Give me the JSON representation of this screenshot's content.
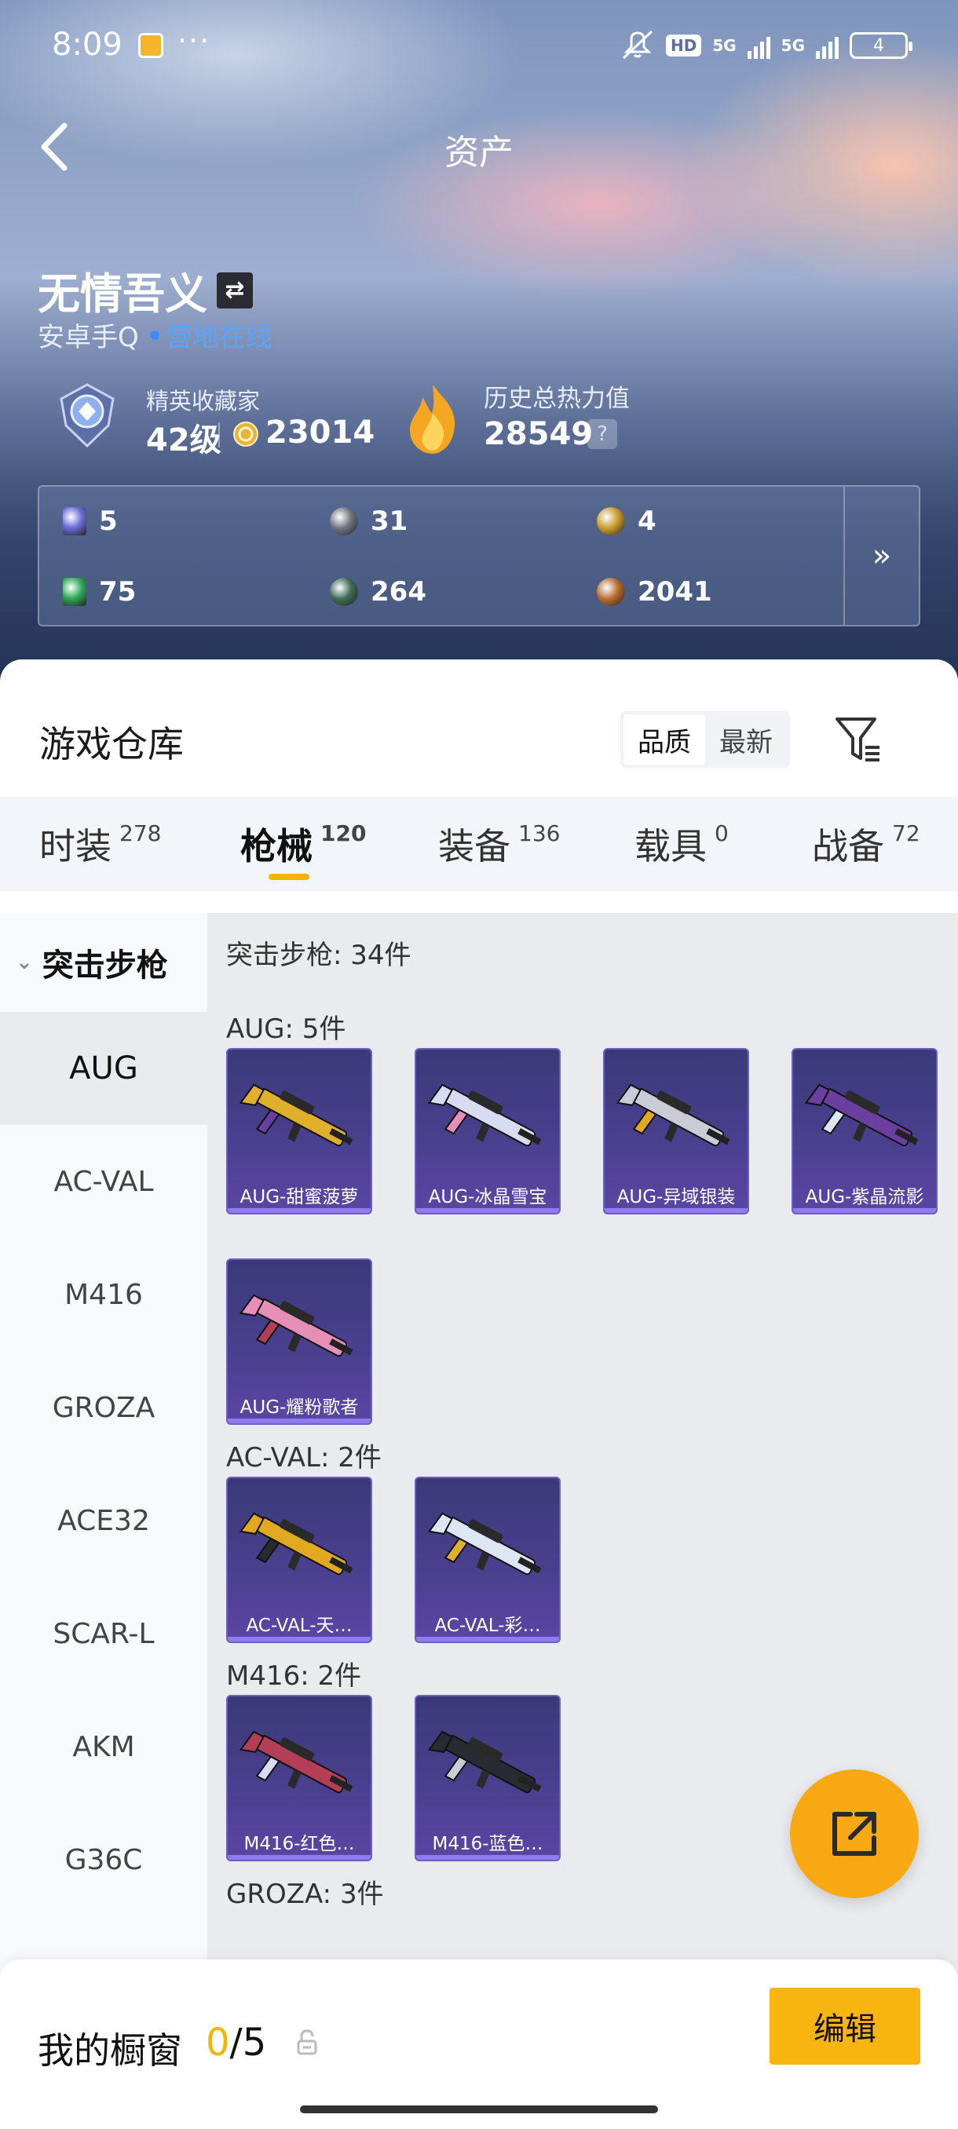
{
  "status_bar": {
    "time": "8:09",
    "hd": "HD",
    "net1": "5G",
    "net2": "5G",
    "battery": "4",
    "dots": "···"
  },
  "nav": {
    "title": "资产"
  },
  "profile": {
    "name": "无情吾义",
    "platform": "安卓手Q",
    "online": "营地在线",
    "rank_title": "精英收藏家",
    "rank_level": "42级",
    "coins": "23014",
    "heat_title": "历史总热力值",
    "heat_value": "28549",
    "help": "?"
  },
  "stats": [
    {
      "icon": "card-purple-icon",
      "value": "5",
      "color": "#6b6fd6"
    },
    {
      "icon": "silver-coin-icon",
      "value": "31",
      "color": "#6c7280"
    },
    {
      "icon": "gold-badge-icon",
      "value": "4",
      "color": "#c79a2a"
    },
    {
      "icon": "card-green-icon",
      "value": "75",
      "color": "#2faa5b"
    },
    {
      "icon": "green-orb-icon",
      "value": "264",
      "color": "#3d6b55"
    },
    {
      "icon": "bronze-orb-icon",
      "value": "2041",
      "color": "#b86a2c"
    }
  ],
  "warehouse": {
    "title": "游戏仓库",
    "sort": [
      "品质",
      "最新"
    ]
  },
  "tabs": [
    {
      "label": "时装",
      "count": "278"
    },
    {
      "label": "枪械",
      "count": "120"
    },
    {
      "label": "装备",
      "count": "136"
    },
    {
      "label": "载具",
      "count": "0"
    },
    {
      "label": "战备",
      "count": "72"
    }
  ],
  "sidebar": {
    "group": "突击步枪",
    "items": [
      "AUG",
      "AC-VAL",
      "M416",
      "GROZA",
      "ACE32",
      "SCAR-L",
      "AKM",
      "G36C"
    ]
  },
  "content": {
    "total": "突击步枪: 34件",
    "sections": [
      {
        "title": "AUG: 5件",
        "items": [
          "AUG-甜蜜菠萝",
          "AUG-冰晶雪宝",
          "AUG-异域银装",
          "AUG-紫晶流影",
          "AUG-耀粉歌者"
        ]
      },
      {
        "title": "AC-VAL: 2件",
        "items": [
          "AC-VAL-天…",
          "AC-VAL-彩…"
        ]
      },
      {
        "title": "M416: 2件",
        "items": [
          "M416-红色…",
          "M416-蓝色…"
        ]
      },
      {
        "title": "GROZA: 3件",
        "items": []
      }
    ]
  },
  "gun_colors": [
    "#e0b02c",
    "#d8dcf3",
    "#c9ccd6",
    "#6b3fa0",
    "#e58fb6",
    "#e0a91f",
    "#dde6f3",
    "#b23f55",
    "#2a2a33"
  ],
  "showcase": {
    "label": "我的橱窗",
    "used": "0",
    "slash_total": "/5",
    "edit": "编辑"
  }
}
